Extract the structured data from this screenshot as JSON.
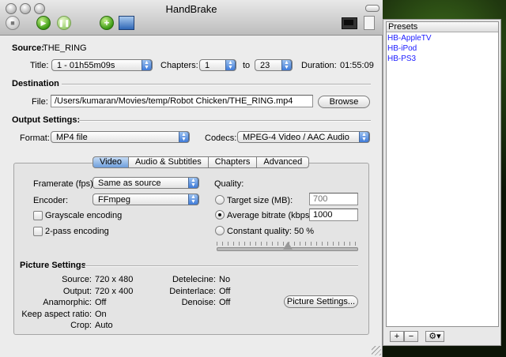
{
  "window": {
    "title": "HandBrake"
  },
  "source": {
    "label": "Source:",
    "value": "THE_RING",
    "title_label": "Title:",
    "title_value": "1 - 01h55m09s",
    "chapters_label": "Chapters:",
    "chapter_start": "1",
    "to_label": "to",
    "chapter_end": "23",
    "duration_label": "Duration:",
    "duration_value": "01:55:09"
  },
  "destination": {
    "heading": "Destination",
    "file_label": "File:",
    "file_value": "/Users/kumaran/Movies/temp/Robot Chicken/THE_RING.mp4",
    "browse_label": "Browse"
  },
  "output": {
    "heading": "Output Settings:",
    "format_label": "Format:",
    "format_value": "MP4 file",
    "codecs_label": "Codecs:",
    "codecs_value": "MPEG-4 Video / AAC Audio"
  },
  "tabs": [
    "Video",
    "Audio & Subtitles",
    "Chapters",
    "Advanced"
  ],
  "video": {
    "framerate_label": "Framerate (fps):",
    "framerate_value": "Same as source",
    "encoder_label": "Encoder:",
    "encoder_value": "FFmpeg",
    "grayscale_label": "Grayscale encoding",
    "twopass_label": "2-pass encoding",
    "quality_label": "Quality:",
    "target_size_label": "Target size (MB):",
    "target_size_value": "700",
    "avg_bitrate_label": "Average bitrate (kbps):",
    "avg_bitrate_value": "1000",
    "constant_quality_label": "Constant quality: 50 %",
    "quality_slider_fraction": 0.5
  },
  "picture": {
    "heading": "Picture Settings",
    "source_label": "Source:",
    "source_value": "720 x 480",
    "output_label": "Output:",
    "output_value": "720 x 400",
    "anamorphic_label": "Anamorphic:",
    "anamorphic_value": "Off",
    "keep_aspect_label": "Keep aspect ratio:",
    "keep_aspect_value": "On",
    "crop_label": "Crop:",
    "crop_value": "Auto",
    "detelecine_label": "Detelecine:",
    "detelecine_value": "No",
    "deinterlace_label": "Deinterlace:",
    "deinterlace_value": "Off",
    "denoise_label": "Denoise:",
    "denoise_value": "Off",
    "settings_button": "Picture Settings..."
  },
  "presets": {
    "heading": "Presets",
    "items": [
      "HB-AppleTV",
      "HB-iPod",
      "HB-PS3"
    ],
    "add_label": "+",
    "remove_label": "−"
  },
  "colors": {
    "preset_link": "#1a1aff",
    "tab_selected": "#6e9fdc"
  }
}
